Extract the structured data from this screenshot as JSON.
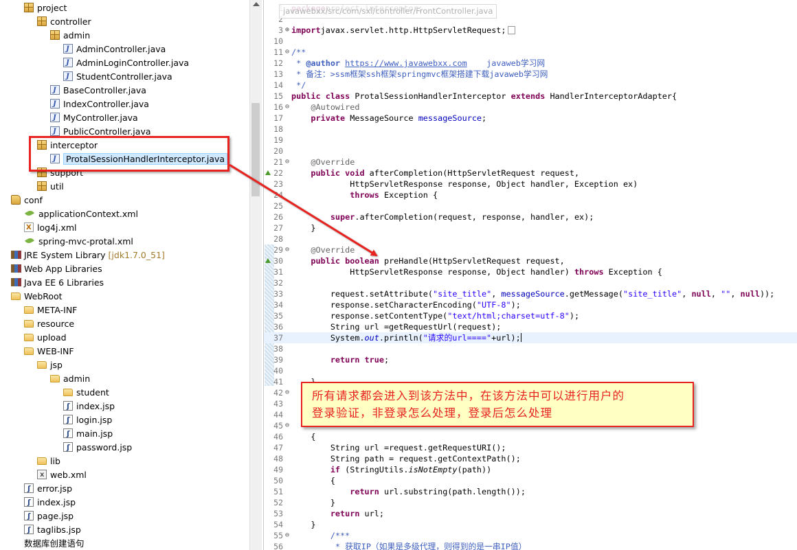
{
  "explorer": {
    "items": [
      {
        "label": "project",
        "icon": "package-icon",
        "indent": 1
      },
      {
        "label": "controller",
        "icon": "package-icon",
        "indent": 2
      },
      {
        "label": "admin",
        "icon": "package-icon",
        "indent": 3
      },
      {
        "label": "AdminController.java",
        "icon": "java-file-icon",
        "indent": 4
      },
      {
        "label": "AdminLoginController.java",
        "icon": "java-file-icon",
        "indent": 4
      },
      {
        "label": "StudentController.java",
        "icon": "java-file-icon",
        "indent": 4
      },
      {
        "label": "BaseController.java",
        "icon": "java-file-icon",
        "indent": 3
      },
      {
        "label": "IndexController.java",
        "icon": "java-file-icon",
        "indent": 3
      },
      {
        "label": "MyController.java",
        "icon": "java-file-icon",
        "indent": 3
      },
      {
        "label": "PublicController.java",
        "icon": "java-file-icon",
        "indent": 3
      },
      {
        "label": "interceptor",
        "icon": "package-icon",
        "indent": 2
      },
      {
        "label": "ProtalSessionHandlerInterceptor.java",
        "icon": "java-file-icon",
        "indent": 3,
        "selected": true
      },
      {
        "label": "support",
        "icon": "package-icon",
        "indent": 2
      },
      {
        "label": "util",
        "icon": "package-icon",
        "indent": 2
      },
      {
        "label": "conf",
        "icon": "source-folder-icon",
        "indent": 0
      },
      {
        "label": "applicationContext.xml",
        "icon": "spring-leaf-icon",
        "indent": 1
      },
      {
        "label": "log4j.xml",
        "icon": "xml-file-icon",
        "indent": 1
      },
      {
        "label": "spring-mvc-protal.xml",
        "icon": "spring-leaf-icon",
        "indent": 1
      },
      {
        "label": "JRE System Library",
        "extra": "[jdk1.7.0_51]",
        "icon": "library-icon",
        "indent": 0
      },
      {
        "label": "Web App Libraries",
        "icon": "library-icon",
        "indent": 0
      },
      {
        "label": "Java EE 6 Libraries",
        "icon": "library-icon",
        "indent": 0
      },
      {
        "label": "WebRoot",
        "icon": "folder-icon",
        "indent": 0
      },
      {
        "label": "META-INF",
        "icon": "folder-icon",
        "indent": 1
      },
      {
        "label": "resource",
        "icon": "folder-icon",
        "indent": 1
      },
      {
        "label": "upload",
        "icon": "folder-icon",
        "indent": 1
      },
      {
        "label": "WEB-INF",
        "icon": "folder-icon",
        "indent": 1
      },
      {
        "label": "jsp",
        "icon": "folder-icon",
        "indent": 2
      },
      {
        "label": "admin",
        "icon": "folder-icon",
        "indent": 3
      },
      {
        "label": "student",
        "icon": "folder-icon",
        "indent": 4
      },
      {
        "label": "index.jsp",
        "icon": "jsp-file-icon",
        "indent": 4
      },
      {
        "label": "login.jsp",
        "icon": "jsp-file-icon",
        "indent": 4
      },
      {
        "label": "main.jsp",
        "icon": "jsp-file-icon",
        "indent": 4
      },
      {
        "label": "password.jsp",
        "icon": "jsp-file-icon",
        "indent": 4
      },
      {
        "label": "lib",
        "icon": "folder-icon",
        "indent": 2
      },
      {
        "label": "web.xml",
        "icon": "web-xml-icon",
        "indent": 2
      },
      {
        "label": "error.jsp",
        "icon": "jsp-file-icon",
        "indent": 1
      },
      {
        "label": "index.jsp",
        "icon": "jsp-file-icon",
        "indent": 1
      },
      {
        "label": "page.jsp",
        "icon": "jsp-file-icon",
        "indent": 1
      },
      {
        "label": "taglibs.jsp",
        "icon": "jsp-file-icon",
        "indent": 1
      },
      {
        "label": "数据库创建语句",
        "icon": "none",
        "indent": 1
      }
    ]
  },
  "editor": {
    "tooltip": "javawebxx/src/com/sxl/controller/FrontController.java",
    "lines": [
      {
        "n": "1",
        "t": [
          [
            "kw",
            "package"
          ],
          [
            "",
            "project.interceptor;"
          ]
        ]
      },
      {
        "n": "2",
        "t": []
      },
      {
        "n": "3",
        "fold": "⊕",
        "t": [
          [
            "kw",
            "import"
          ],
          [
            "",
            "javax.servlet.http.HttpServletRequest;"
          ]
        ],
        "box": true
      },
      {
        "n": "10",
        "t": []
      },
      {
        "n": "11",
        "fold": "⊖",
        "t": [
          [
            "cm",
            "/**"
          ]
        ]
      },
      {
        "n": "12",
        "t": [
          [
            "cm",
            " * "
          ],
          [
            "cmb",
            "@author"
          ],
          [
            "cm",
            " "
          ],
          [
            "url",
            "https://www.javawebxx.com"
          ],
          [
            "cm",
            "    javaweb学习网"
          ]
        ]
      },
      {
        "n": "13",
        "t": [
          [
            "cm",
            " * 备注：>ssm框架ssh框架springmvc框架搭建下载javaweb学习网"
          ]
        ]
      },
      {
        "n": "14",
        "t": [
          [
            "cm",
            " */"
          ]
        ]
      },
      {
        "n": "15",
        "t": [
          [
            "kw",
            "public class"
          ],
          [
            "",
            " ProtalSessionHandlerInterceptor "
          ],
          [
            "kw",
            "extends"
          ],
          [
            "",
            " HandlerInterceptorAdapter{"
          ]
        ]
      },
      {
        "n": "16",
        "fold": "⊖",
        "t": [
          [
            "",
            "    "
          ],
          [
            "ann",
            "@Autowired"
          ]
        ]
      },
      {
        "n": "17",
        "t": [
          [
            "",
            "    "
          ],
          [
            "kw",
            "private"
          ],
          [
            "",
            " MessageSource "
          ],
          [
            "fld",
            "messageSource"
          ],
          [
            "",
            ";"
          ]
        ]
      },
      {
        "n": "18",
        "t": []
      },
      {
        "n": "19",
        "t": []
      },
      {
        "n": "20",
        "t": []
      },
      {
        "n": "21",
        "fold": "⊖",
        "t": [
          [
            "",
            "    "
          ],
          [
            "ann",
            "@Override"
          ]
        ]
      },
      {
        "n": "22",
        "mark": true,
        "t": [
          [
            "",
            "    "
          ],
          [
            "kw",
            "public void"
          ],
          [
            "",
            " afterCompletion(HttpServletRequest request,"
          ]
        ]
      },
      {
        "n": "23",
        "t": [
          [
            "",
            "            HttpServletResponse response, Object handler, Exception ex)"
          ]
        ]
      },
      {
        "n": "24",
        "t": [
          [
            "",
            "            "
          ],
          [
            "kw",
            "throws"
          ],
          [
            "",
            " Exception {"
          ]
        ]
      },
      {
        "n": "25",
        "t": []
      },
      {
        "n": "26",
        "t": [
          [
            "",
            "        "
          ],
          [
            "kw",
            "super"
          ],
          [
            "",
            ".afterCompletion(request, response, handler, ex);"
          ]
        ]
      },
      {
        "n": "27",
        "t": [
          [
            "",
            "    }"
          ]
        ]
      },
      {
        "n": "28",
        "t": []
      },
      {
        "n": "29",
        "fold": "⊖",
        "t": [
          [
            "",
            "    "
          ],
          [
            "ann",
            "@Override"
          ]
        ]
      },
      {
        "n": "30",
        "mark": true,
        "t": [
          [
            "",
            "    "
          ],
          [
            "kw",
            "public boolean"
          ],
          [
            "",
            " preHandle(HttpServletRequest request,"
          ]
        ]
      },
      {
        "n": "31",
        "t": [
          [
            "",
            "            HttpServletResponse response, Object handler) "
          ],
          [
            "kw",
            "throws"
          ],
          [
            "",
            " Exception {"
          ]
        ]
      },
      {
        "n": "32",
        "t": []
      },
      {
        "n": "33",
        "t": [
          [
            "",
            "        request.setAttribute("
          ],
          [
            "str",
            "\"site_title\""
          ],
          [
            "",
            ", "
          ],
          [
            "fld",
            "messageSource"
          ],
          [
            "",
            ".getMessage("
          ],
          [
            "str",
            "\"site_title\""
          ],
          [
            "",
            ", "
          ],
          [
            "kw",
            "null"
          ],
          [
            "",
            ", "
          ],
          [
            "str",
            "\"\""
          ],
          [
            "",
            ", "
          ],
          [
            "kw",
            "null"
          ],
          [
            "",
            "));"
          ]
        ]
      },
      {
        "n": "34",
        "t": [
          [
            "",
            "        response.setCharacterEncoding("
          ],
          [
            "str",
            "\"UTF-8\""
          ],
          [
            "",
            ");"
          ]
        ]
      },
      {
        "n": "35",
        "t": [
          [
            "",
            "        response.setContentType("
          ],
          [
            "str",
            "\"text/html;charset=utf-8\""
          ],
          [
            "",
            ");"
          ]
        ]
      },
      {
        "n": "36",
        "t": [
          [
            "",
            "        String url =getRequestUrl(request);"
          ]
        ]
      },
      {
        "n": "37",
        "cur": true,
        "t": [
          [
            "",
            "        System."
          ],
          [
            "fldi",
            "out"
          ],
          [
            "",
            ".println("
          ],
          [
            "str",
            "\"请求的url====\""
          ],
          [
            "",
            "+url);"
          ]
        ],
        "caret": true
      },
      {
        "n": "38",
        "t": []
      },
      {
        "n": "39",
        "t": [
          [
            "",
            "        "
          ],
          [
            "kw",
            "return true"
          ],
          [
            "",
            ";"
          ]
        ]
      },
      {
        "n": "40",
        "t": []
      },
      {
        "n": "41",
        "t": [
          [
            "",
            "    }"
          ]
        ]
      },
      {
        "n": "42",
        "fold": "⊖",
        "t": []
      },
      {
        "n": "43",
        "t": []
      },
      {
        "n": "44",
        "t": []
      },
      {
        "n": "45",
        "fold": "⊖",
        "t": []
      },
      {
        "n": "46",
        "t": [
          [
            "",
            "    {"
          ]
        ]
      },
      {
        "n": "47",
        "t": [
          [
            "",
            "        String url =request.getRequestURI();"
          ]
        ]
      },
      {
        "n": "48",
        "t": [
          [
            "",
            "        String path = request.getContextPath();"
          ]
        ]
      },
      {
        "n": "49",
        "t": [
          [
            "",
            "        "
          ],
          [
            "kw",
            "if"
          ],
          [
            "",
            " (StringUtils."
          ],
          [
            "ital",
            "isNotEmpty"
          ],
          [
            "",
            "(path))"
          ]
        ]
      },
      {
        "n": "50",
        "t": [
          [
            "",
            "        {"
          ]
        ]
      },
      {
        "n": "51",
        "t": [
          [
            "",
            "            "
          ],
          [
            "kw",
            "return"
          ],
          [
            "",
            " url.substring(path.length());"
          ]
        ]
      },
      {
        "n": "52",
        "t": [
          [
            "",
            "        }"
          ]
        ]
      },
      {
        "n": "53",
        "t": [
          [
            "",
            "        "
          ],
          [
            "kw",
            "return"
          ],
          [
            "",
            " url;"
          ]
        ]
      },
      {
        "n": "54",
        "t": [
          [
            "",
            "    }"
          ]
        ]
      },
      {
        "n": "55",
        "fold": "⊖",
        "t": [
          [
            "",
            "        "
          ],
          [
            "cm",
            "/***"
          ]
        ]
      },
      {
        "n": "56",
        "t": [
          [
            "cm",
            "         * 获取IP（如果是多级代理，则得到的是一串IP值）"
          ]
        ]
      }
    ]
  },
  "callout": {
    "line1": "所有请求都会进入到该方法中，在该方法中可以进行用户的",
    "line2": "登录验证，非登录怎么处理，登录后怎么处理"
  },
  "colors": {
    "annotation_red": "#e8231f",
    "callout_bg": "#ffffc4",
    "keyword": "#7f0055",
    "comment": "#3f5fbf",
    "string": "#2a00ff"
  }
}
